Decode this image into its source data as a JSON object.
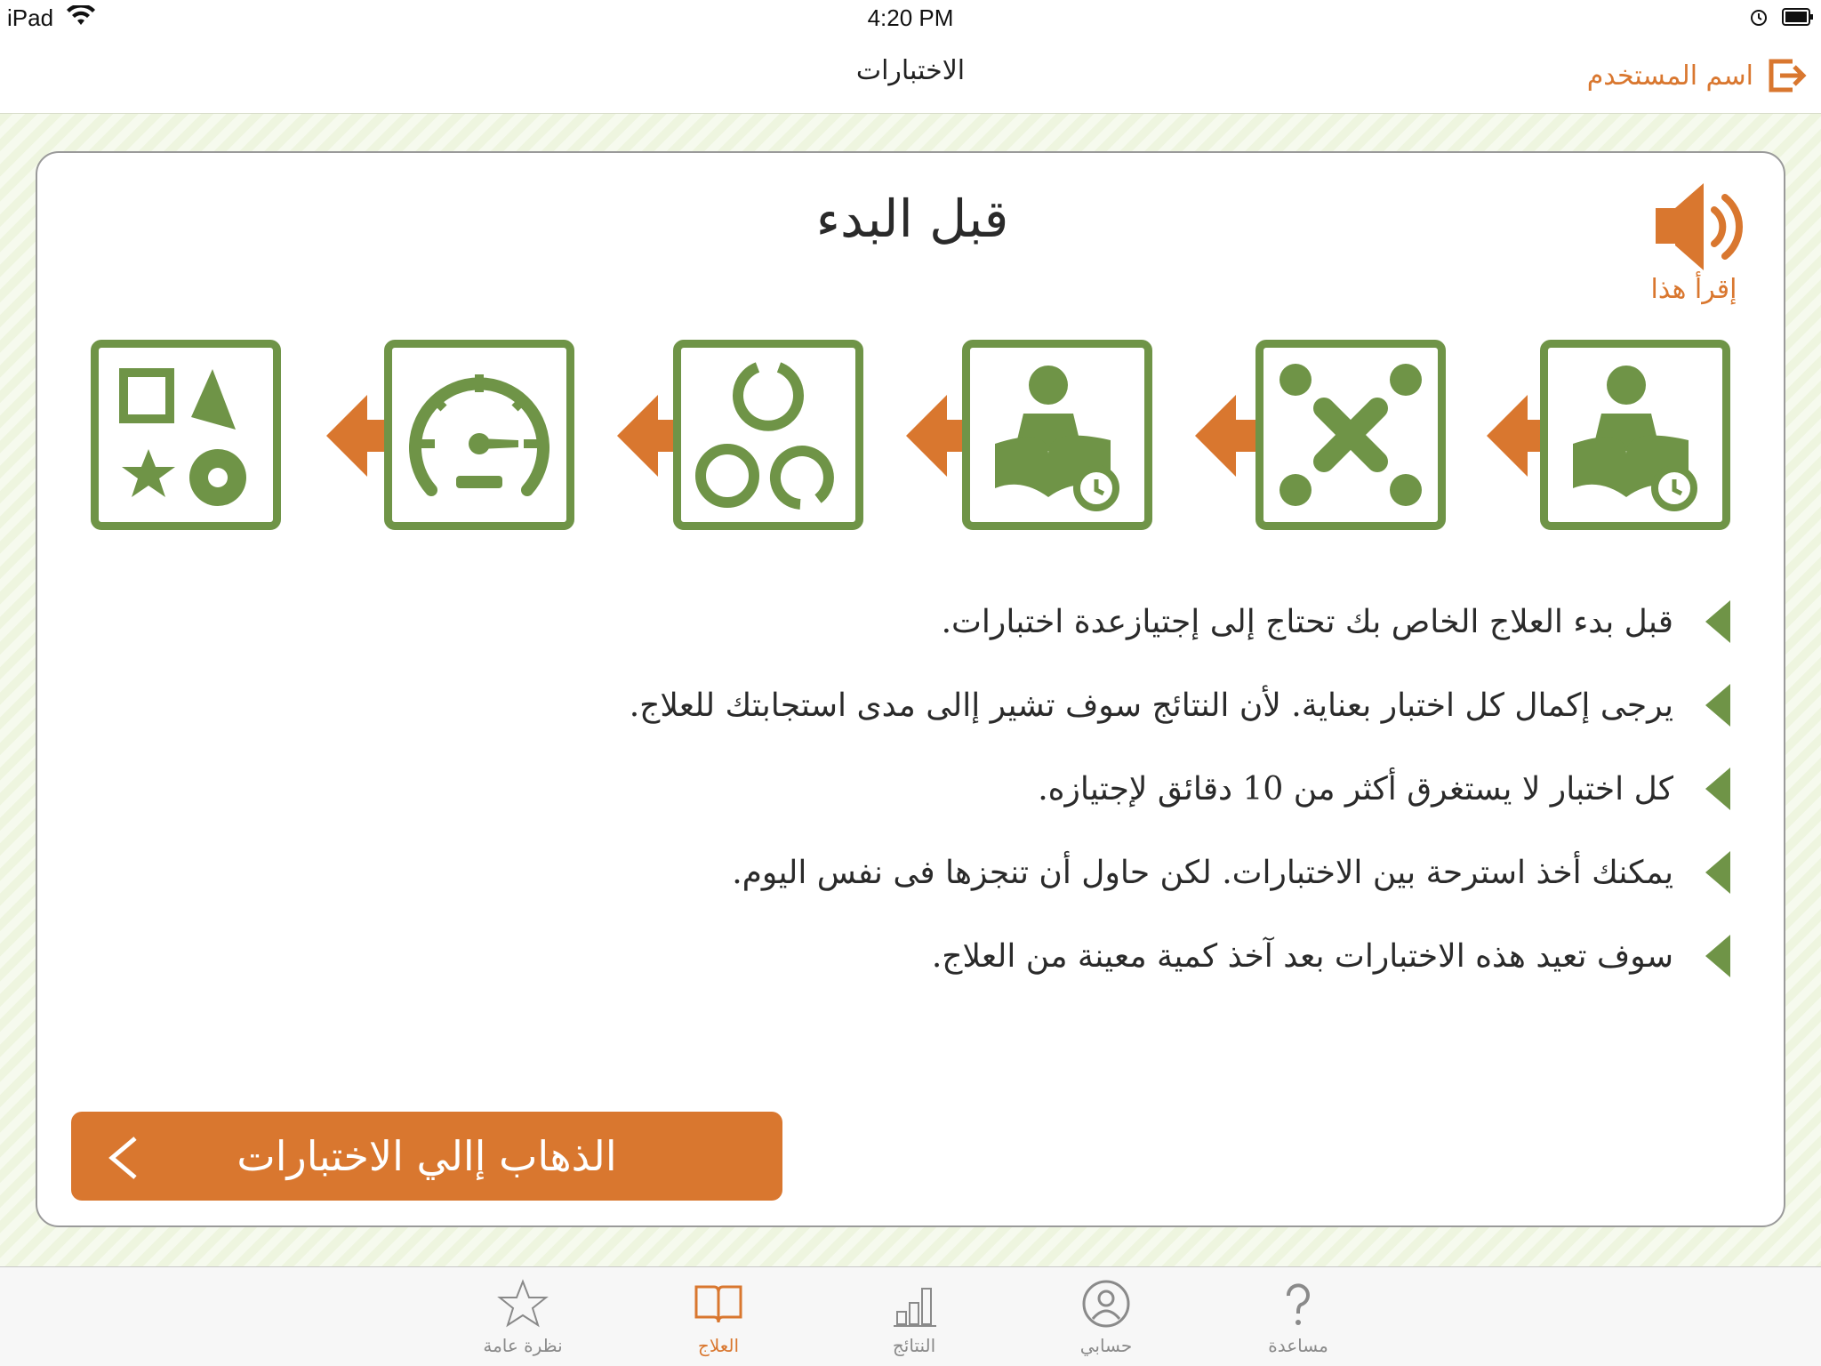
{
  "status_bar": {
    "device": "iPad",
    "time": "4:20 PM"
  },
  "nav": {
    "title": "الاختبارات",
    "user_label": "اسم المستخدم"
  },
  "card": {
    "title": "قبل البدء",
    "read_this_label": "إقرأ هذا",
    "bullets": [
      "قبل بدء العلاج الخاص بك تحتاج إلى إجتيازعدة اختبارات.",
      "يرجى إكمال كل اختبار بعناية. لأن النتائج سوف تشير إالى مدى استجابتك للعلاج.",
      "كل اختبار لا يستغرق أكثر من 10 دقائق لإجتيازه.",
      "يمكنك أخذ استرحة بين الاختبارات. لكن حاول أن تنجزها فى نفس اليوم.",
      "سوف تعيد هذه الاختبارات بعد آخذ كمية معينة من العلاج."
    ],
    "go_button_label": "الذهاب إالي الاختبارات"
  },
  "steps": [
    "reading-timer-icon",
    "dots-cross-icon",
    "reading-timer-icon",
    "circles-icon",
    "speedometer-icon",
    "shapes-icon"
  ],
  "tabs": [
    {
      "label": "مساعدة",
      "icon": "question-icon",
      "active": false
    },
    {
      "label": "حسابي",
      "icon": "person-icon",
      "active": false
    },
    {
      "label": "النتائج",
      "icon": "bar-chart-icon",
      "active": false
    },
    {
      "label": "العلاج",
      "icon": "book-icon",
      "active": true
    },
    {
      "label": "نظرة عامة",
      "icon": "star-icon",
      "active": false
    }
  ],
  "colors": {
    "accent_orange": "#d9772f",
    "icon_green": "#6f9447"
  }
}
